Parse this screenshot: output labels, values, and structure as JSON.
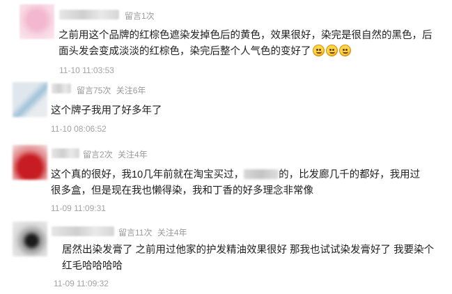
{
  "comments": [
    {
      "stats": {
        "messages": "留言1次",
        "follows": ""
      },
      "text": [
        "之前用这个品牌的红棕色遮染发掉色后的黄色，效果很好，染完是很自然的黑色，后",
        "面头发会变成淡淡的红棕色，染完后整个人气色的变好了"
      ],
      "emoji": "grinning-emoji-icon",
      "time": "11-10 11:03:53"
    },
    {
      "stats": {
        "messages": "留言75次",
        "follows": "关注6年"
      },
      "text": [
        "这个牌子我用了好多年了"
      ],
      "time": "11-10 08:06:52"
    },
    {
      "stats": {
        "messages": "留言2次",
        "follows": "关注4年"
      },
      "text_a": "这个真的很好，我10几年前就在淘宝买过，",
      "text_b": "的，比发廊几千的都好，我用过",
      "text_2": "很多盒，但是现在我也懒得染，我和丁香的好多理念非常像",
      "time": "11-09 11:09:31"
    },
    {
      "stats": {
        "messages": "留言11次",
        "follows": "关注4年"
      },
      "text": [
        "居然出染发膏了 之前用过他家的护发精油效果很好 那我也试试染发膏好了 我要染个",
        "红毛哈哈哈哈"
      ],
      "time": "11-09 11:09:32"
    }
  ],
  "colors": {
    "meta": "#9a9a9a",
    "time": "#a3a3a3",
    "text": "#1e1e1e"
  }
}
